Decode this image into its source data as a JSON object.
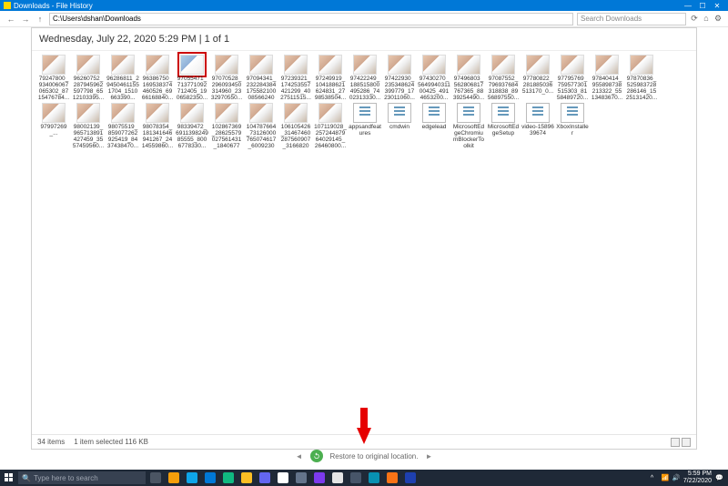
{
  "window": {
    "title": "Downloads - File History",
    "min": "—",
    "max": "☐",
    "close": "✕"
  },
  "nav": {
    "back": "←",
    "fwd": "→",
    "up": "↑",
    "path": "C:\\Users\\dshan\\Downloads",
    "search_placeholder": "Search Downloads",
    "refresh": "⟳",
    "home": "⌂",
    "gear": "⚙"
  },
  "heading": "Wednesday, July 22, 2020 5:29 PM   |   1 of 1",
  "items_row1": [
    "79247800_934006067065302_8715476784...",
    "96260752_287945962597798_6512103395...",
    "96286811_294504611551704_1510663390...",
    "96386750_169538374460526_6966168840...",
    "97055471_713771092712405_1906582350...",
    "97070528_296093450314960_2332970550...",
    "97094341_232284384175582100085662400...",
    "97239321_174253557421299_4027511515...",
    "97249919_104188621624831_2798538504...",
    "97422249_188515800495286_7402313330...",
    "97422930_235348624399779_1723011060...",
    "97430270_564994031100425_4914653200...",
    "97496803_562806817767365_8839254490...",
    "97087552_796937684318838_8956897550...",
    "97780822_281885036513170_0...",
    "97795769_759577301515303_8158489720...",
    "97840414_955898738213322_5513483670...",
    "97870836_525983728286146_1525131420...",
    "97997269_..."
  ],
  "items_row2": [
    "98002139_965713891427459_3557459560...",
    "98075519_859077262925419_8437438470...",
    "98078354_181341646941267_2414559860...",
    "98339472_691139824985555_8006778330...",
    "102867369_28625579027561431_18406770...",
    "104787664_73126000765074617_60092300...",
    "106105426_31467460287560907_31668200...",
    "107119028_25724487964029145_26460800...",
    "appsandfeatures",
    "cmdwin",
    "edgelead",
    "MicrosoftEdgeChromiumBlockerToolkit",
    "MicrosoftEdgeSetup",
    "video-1589639674",
    "XboxInstaller"
  ],
  "selected_index": 4,
  "status": {
    "count": "34 items",
    "selection": "1 item selected  116 KB"
  },
  "restore": {
    "prev": "◄",
    "next": "►",
    "label": "Restore to original location."
  },
  "taskbar": {
    "search": "Type here to search",
    "time": "5:59 PM",
    "date": "7/22/2020"
  }
}
